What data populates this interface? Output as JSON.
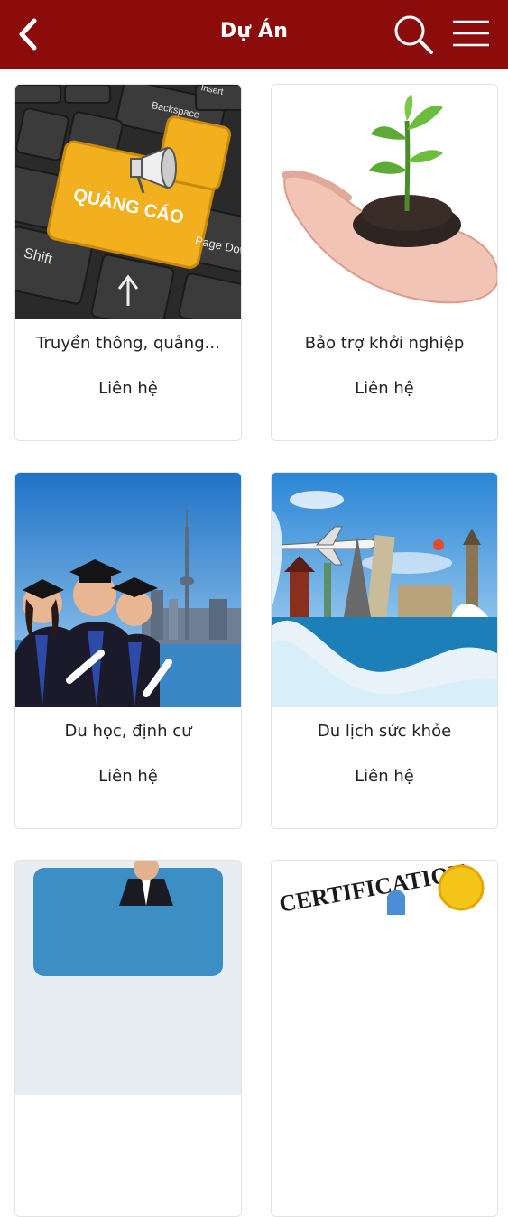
{
  "header": {
    "title": "Dự Án",
    "icons": {
      "back": "chevron-left-icon",
      "search": "search-icon",
      "menu": "hamburger-menu-icon"
    },
    "background": "#8c0c0c"
  },
  "projects": [
    {
      "name": "Truyền thông, quảng...",
      "price": "Liên hệ",
      "image": {
        "label": "QUẢNG CÁO",
        "keys": [
          "Backspace",
          "Insert",
          "Shift",
          "Page Down"
        ]
      }
    },
    {
      "name": "Bảo trợ khởi nghiệp",
      "price": "Liên hệ",
      "image": {}
    },
    {
      "name": "Du học, định cư",
      "price": "Liên hệ",
      "image": {}
    },
    {
      "name": "Du lịch sức khỏe",
      "price": "Liên hệ",
      "image": {}
    },
    {
      "name": "",
      "price": "",
      "image": {}
    },
    {
      "name": "",
      "price": "",
      "image": {
        "label": "CERTIFICATION"
      }
    }
  ]
}
